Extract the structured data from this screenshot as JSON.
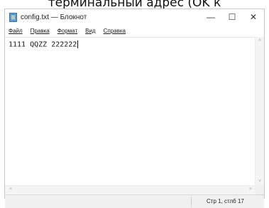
{
  "top_caption": "терминальный адрес (OK к",
  "window": {
    "title": "config.txt — Блокнот",
    "controls": {
      "minimize": "—",
      "maximize": "☐",
      "close": "✕"
    }
  },
  "menu": {
    "items": [
      {
        "label": "Файл"
      },
      {
        "label": "Правка"
      },
      {
        "label": "Формат"
      },
      {
        "label": "Вид"
      },
      {
        "label": "Справка"
      }
    ]
  },
  "editor": {
    "content": "1111 QQZZ 222222"
  },
  "scrollbars": {
    "up": "˄",
    "down": "˅",
    "left": "˂",
    "right": "˃"
  },
  "status": {
    "position": "Стр 1, стлб 17"
  },
  "icons": [
    "notepad-icon",
    "minimize-icon",
    "maximize-icon",
    "close-icon",
    "scroll-up-icon",
    "scroll-down-icon",
    "scroll-left-icon",
    "scroll-right-icon"
  ]
}
